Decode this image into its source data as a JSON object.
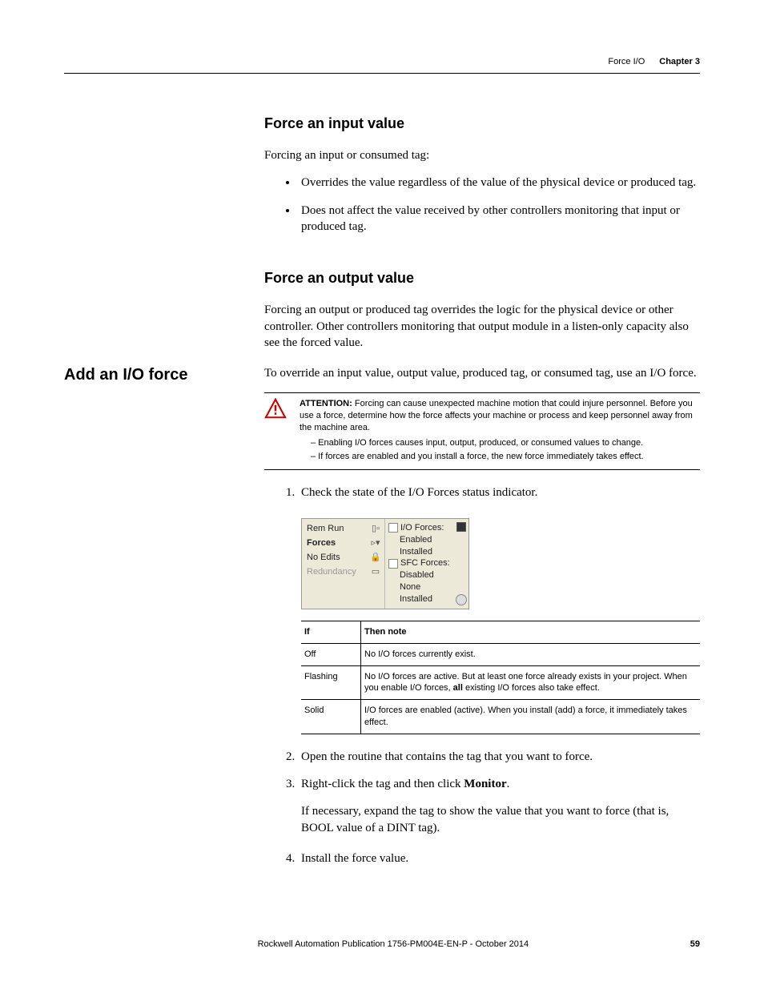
{
  "header": {
    "section": "Force I/O",
    "chapter": "Chapter 3"
  },
  "subhead1": "Force an input value",
  "intro1": "Forcing an input or consumed tag:",
  "bullets1": [
    "Overrides the value regardless of the value of the physical device or produced tag.",
    "Does not affect the value received by other controllers monitoring that input or produced tag."
  ],
  "subhead2": "Force an output value",
  "para2": "Forcing an output or produced tag overrides the logic for the physical device or other controller. Other controllers monitoring that output module in a listen-only capacity also see the forced value.",
  "sidehead": "Add an I/O force",
  "sidepara": "To override an input value, output value, produced tag, or consumed tag, use an I/O force.",
  "attention": {
    "lead": "ATTENTION:",
    "body": " Forcing can cause unexpected machine motion that could injure personnel. Before you use a force, determine how the force affects your machine or process and keep personnel away from the machine area.",
    "subs": [
      "– Enabling I/O forces causes input, output, produced, or consumed values to change.",
      "– If forces are enabled and you install a force, the new force immediately takes effect."
    ]
  },
  "step1": "Check the state of the I/O Forces status indicator.",
  "statusimg": {
    "left": {
      "r1": "Rem Run",
      "r2": "Forces",
      "r3": "No Edits",
      "r4": "Redundancy"
    },
    "mid": {
      "l1": "I/O Forces:",
      "l1a": "Enabled",
      "l1b": "Installed",
      "l2": "SFC Forces:",
      "l2a": "Disabled",
      "l2b": "None Installed"
    }
  },
  "table": {
    "h1": "If",
    "h2": "Then note",
    "rows": [
      {
        "c1": "Off",
        "c2": "No I/O forces currently exist."
      },
      {
        "c1": "Flashing",
        "c2_pre": "No I/O forces are active. But at least one force already exists in your project. When you enable I/O forces, ",
        "c2_bold": "all",
        "c2_post": " existing I/O forces also take effect."
      },
      {
        "c1": "Solid",
        "c2": "I/O forces are enabled (active). When you install (add) a force, it immediately takes effect."
      }
    ]
  },
  "step2": "Open the routine that contains the tag that you want to force.",
  "step3_pre": "Right-click the tag and then click ",
  "step3_bold": "Monitor",
  "step3_post": ".",
  "step3_note": "If necessary, expand the tag to show the value that you want to force (that is, BOOL value of a DINT tag).",
  "step4": "Install the force value.",
  "footer": {
    "pub": "Rockwell Automation Publication 1756-PM004E-EN-P - October 2014",
    "page": "59"
  }
}
